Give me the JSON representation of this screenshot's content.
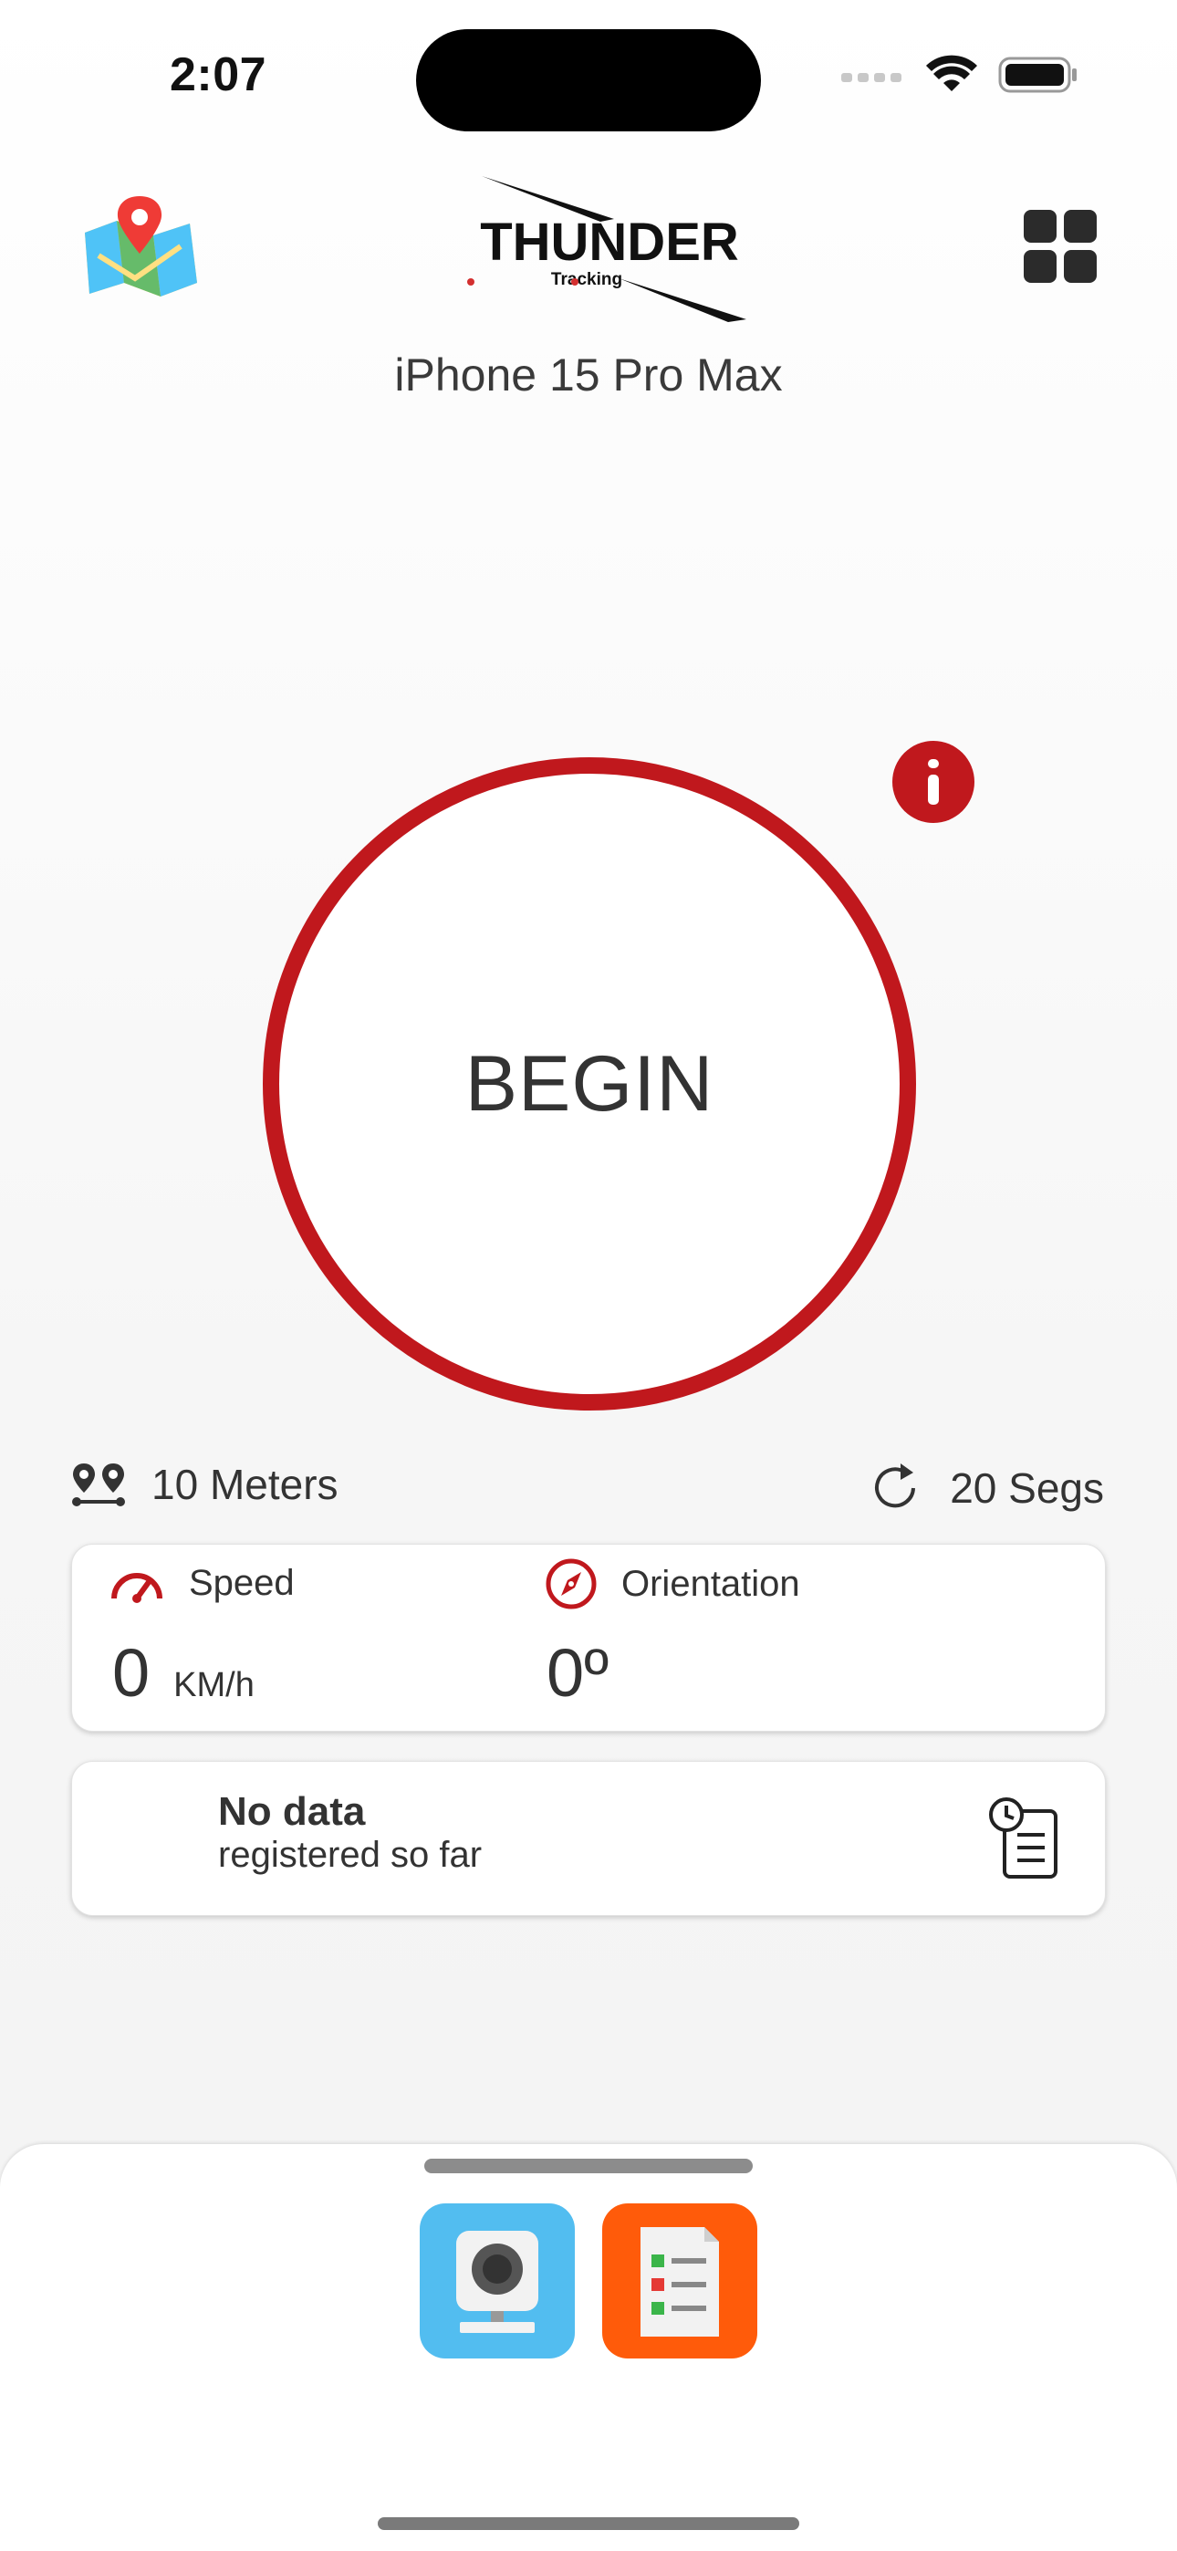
{
  "status_bar": {
    "time": "2:07"
  },
  "header": {
    "logo_text": "THUNDER",
    "logo_sub": "Tracking",
    "device_name": "iPhone 15 Pro Max"
  },
  "main": {
    "begin_label": "BEGIN"
  },
  "stats": {
    "distance": "10 Meters",
    "interval": "20 Segs"
  },
  "metrics": {
    "speed_title": "Speed",
    "speed_value": "0",
    "speed_unit": "KM/h",
    "orientation_title": "Orientation",
    "orientation_value": "0º"
  },
  "records": {
    "title": "No data",
    "subtitle": "registered so far"
  },
  "icons": {
    "map": "map-icon",
    "grid": "grid-menu-icon",
    "info": "info-icon",
    "distance": "waypoints-icon",
    "interval": "refresh-icon",
    "speed": "speedometer-icon",
    "orientation": "compass-icon",
    "history": "clipboard-clock-icon",
    "camera_app": "webcam-app-icon",
    "report_app": "report-app-icon"
  },
  "colors": {
    "accent": "#c0181d",
    "camera_app_bg": "#52bdf0",
    "report_app_bg": "#ff5b0a"
  }
}
